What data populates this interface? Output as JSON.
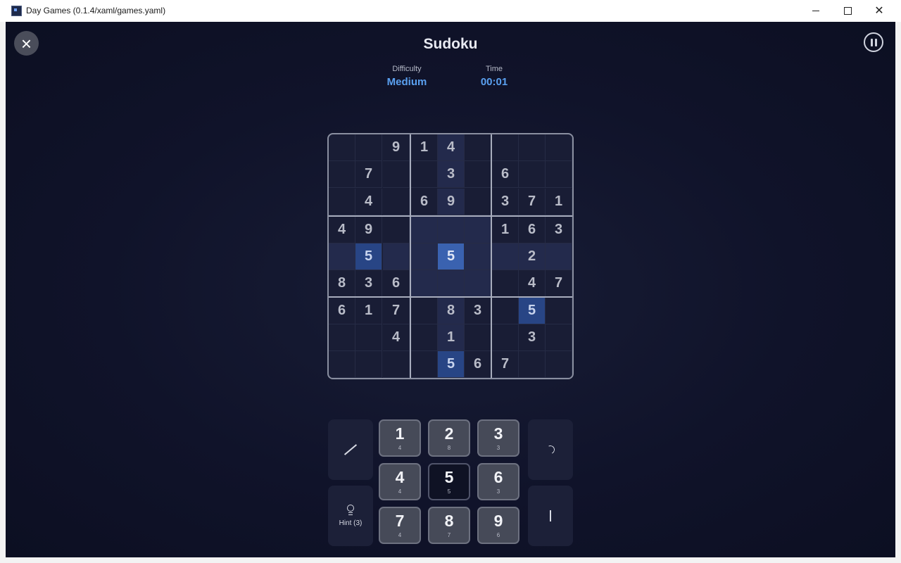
{
  "window": {
    "title": "Day Games (0.1.4/xaml/games.yaml)"
  },
  "header": {
    "title": "Sudoku",
    "difficulty_label": "Difficulty",
    "difficulty_value": "Medium",
    "time_label": "Time",
    "time_value": "00:01"
  },
  "board": {
    "rows": [
      [
        "",
        "",
        "9",
        "1",
        "4",
        "",
        "",
        "",
        ""
      ],
      [
        "",
        "7",
        "",
        "",
        "3",
        "",
        "6",
        "",
        ""
      ],
      [
        "",
        "4",
        "",
        "6",
        "9",
        "",
        "3",
        "7",
        "1"
      ],
      [
        "4",
        "9",
        "",
        "",
        "",
        "",
        "1",
        "6",
        "3"
      ],
      [
        "",
        "5",
        "",
        "",
        "5",
        "",
        "",
        "2",
        ""
      ],
      [
        "8",
        "3",
        "6",
        "",
        "",
        "",
        "",
        "4",
        "7"
      ],
      [
        "6",
        "1",
        "7",
        "",
        "8",
        "3",
        "",
        "5",
        ""
      ],
      [
        "",
        "",
        "4",
        "",
        "1",
        "",
        "",
        "3",
        ""
      ],
      [
        "",
        "",
        "",
        "",
        "5",
        "6",
        "7",
        "",
        ""
      ]
    ],
    "selected": [
      4,
      4
    ]
  },
  "controls": {
    "hint_label": "Hint (3)",
    "numbers": [
      {
        "value": "1",
        "count": "4"
      },
      {
        "value": "2",
        "count": "8"
      },
      {
        "value": "3",
        "count": "3"
      },
      {
        "value": "4",
        "count": "4"
      },
      {
        "value": "5",
        "count": "5"
      },
      {
        "value": "6",
        "count": "3"
      },
      {
        "value": "7",
        "count": "4"
      },
      {
        "value": "8",
        "count": "7"
      },
      {
        "value": "9",
        "count": "6"
      }
    ],
    "active_number": "5"
  },
  "colors": {
    "accent": "#5aa0f0",
    "background": "#10132a",
    "selected_cell": "#3a62b0",
    "same_value_cell": "#284585"
  },
  "icons": {
    "close": "close-icon",
    "pause": "pause-icon",
    "pencil": "pencil-icon",
    "hint": "lightbulb-icon",
    "undo": "undo-icon",
    "erase": "eraser-icon"
  }
}
